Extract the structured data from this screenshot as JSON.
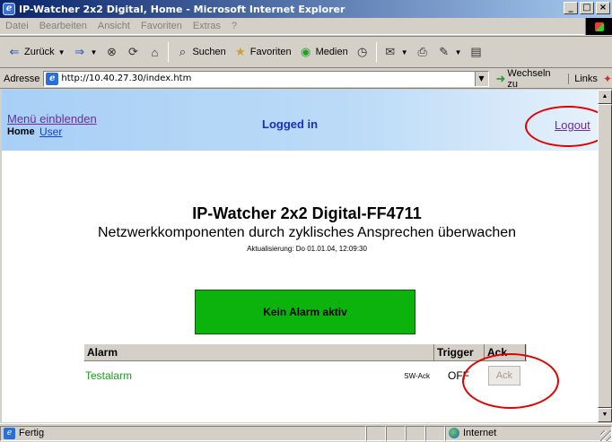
{
  "window": {
    "title": "IP-Watcher 2x2 Digital, Home - Microsoft Internet Explorer",
    "controls": {
      "minimize": "_",
      "maximize": "□",
      "close": "×"
    }
  },
  "menubar": {
    "items": [
      "Datei",
      "Bearbeiten",
      "Ansicht",
      "Favoriten",
      "Extras",
      "?"
    ]
  },
  "toolbar": {
    "back_label": "Zurück",
    "search_label": "Suchen",
    "favorites_label": "Favoriten",
    "media_label": "Medien"
  },
  "addressbar": {
    "label": "Adresse",
    "url": "http://10.40.27.30/index.htm",
    "go_label": "Wechseln zu",
    "links_label": "Links"
  },
  "page": {
    "header": {
      "menu_link": "Menü einblenden",
      "home_label": "Home",
      "user_link": "User",
      "status": "Logged in",
      "logout_link": "Logout"
    },
    "title": "IP-Watcher 2x2 Digital-FF4711",
    "subtitle": "Netzwerkkomponenten durch zyklisches Ansprechen überwachen",
    "update_info": "Aktualisierung:  Do 01.01.04, 12:09:30",
    "alarm_status": "Kein Alarm aktiv",
    "table": {
      "headers": {
        "alarm": "Alarm",
        "trigger": "Trigger",
        "ack": "Ack"
      },
      "rows": [
        {
          "name": "Testalarm",
          "mode": "SW-Ack",
          "trigger": "OFF",
          "ack_button": "Ack"
        }
      ]
    }
  },
  "statusbar": {
    "status_text": "Fertig",
    "zone": "Internet"
  },
  "colors": {
    "alarm_ok_green": "#0db30d",
    "annotation_red": "#e00000",
    "header_blue": "#a8cff6"
  }
}
